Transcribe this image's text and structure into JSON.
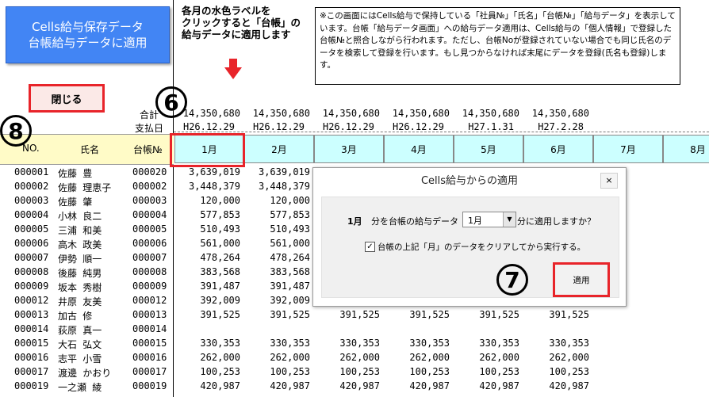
{
  "banner": {
    "line1": "Cells給与保存データ",
    "line2": "台帳給与データに適用"
  },
  "close_button": "閉じる",
  "instruction": {
    "l1": "各月の水色ラベルを",
    "l2": "クリックすると「台帳」の",
    "l3": "給与データに適用します"
  },
  "notice": "※この画面にはCells給与で保持している「社員№」「氏名」「台帳№」「給与データ」を表示しています。台帳「給与データ画面」への給与データ適用は、Cells給与の「個人情報」で登録した台帳№と照合しながら行われます。ただし、台帳Noが登録されていない場合でも同じ氏名のデータを検索して登録を行います。もし見つからなければ末尾にデータを登録(氏名も登録)します。",
  "totals": {
    "label": "合計",
    "values": [
      "14,350,680",
      "14,350,680",
      "14,350,680",
      "14,350,680",
      "14,350,680",
      "14,350,680"
    ]
  },
  "paydates": {
    "label": "支払日",
    "values": [
      "H26.12.29",
      "H26.12.29",
      "H26.12.29",
      "H26.12.29",
      "H27.1.31",
      "H27.2.28"
    ]
  },
  "columns": {
    "no": "NO.",
    "name": "氏名",
    "ledger": "台帳№"
  },
  "months": [
    "1月",
    "2月",
    "3月",
    "4月",
    "5月",
    "6月",
    "7月",
    "8月"
  ],
  "rows": [
    {
      "no": "000001",
      "name": "佐藤 豊",
      "ledger": "000020",
      "v": [
        "3,639,019",
        "3,639,019",
        "",
        "",
        "",
        "",
        ""
      ]
    },
    {
      "no": "000002",
      "name": "佐藤 理恵子",
      "ledger": "000002",
      "v": [
        "3,448,379",
        "3,448,379",
        "",
        "",
        "",
        "",
        ""
      ]
    },
    {
      "no": "000003",
      "name": "佐藤 肇",
      "ledger": "000003",
      "v": [
        "120,000",
        "120,000",
        "",
        "",
        "",
        "",
        ""
      ]
    },
    {
      "no": "000004",
      "name": "小林 良二",
      "ledger": "000004",
      "v": [
        "577,853",
        "577,853",
        "",
        "",
        "",
        "",
        ""
      ]
    },
    {
      "no": "000005",
      "name": "三浦 和美",
      "ledger": "000005",
      "v": [
        "510,493",
        "510,493",
        "",
        "",
        "",
        "",
        ""
      ]
    },
    {
      "no": "000006",
      "name": "高木 政美",
      "ledger": "000006",
      "v": [
        "561,000",
        "561,000",
        "",
        "",
        "",
        "",
        ""
      ]
    },
    {
      "no": "000007",
      "name": "伊勢 順一",
      "ledger": "000007",
      "v": [
        "478,264",
        "478,264",
        "",
        "",
        "",
        "",
        ""
      ]
    },
    {
      "no": "000008",
      "name": "後藤 純男",
      "ledger": "000008",
      "v": [
        "383,568",
        "383,568",
        "",
        "",
        "",
        "",
        ""
      ]
    },
    {
      "no": "000009",
      "name": "坂本 秀樹",
      "ledger": "000009",
      "v": [
        "391,487",
        "391,487",
        "",
        "",
        "",
        "",
        ""
      ]
    },
    {
      "no": "000012",
      "name": "井原 友美",
      "ledger": "000012",
      "v": [
        "392,009",
        "392,009",
        "",
        "",
        "",
        "",
        ""
      ]
    },
    {
      "no": "000013",
      "name": "加古 修",
      "ledger": "000013",
      "v": [
        "391,525",
        "391,525",
        "391,525",
        "391,525",
        "391,525",
        "391,525"
      ]
    },
    {
      "no": "000014",
      "name": "荻原 真一",
      "ledger": "000014",
      "v": [
        "",
        "",
        "",
        "",
        "",
        ""
      ]
    },
    {
      "no": "000015",
      "name": "大石 弘文",
      "ledger": "000015",
      "v": [
        "330,353",
        "330,353",
        "330,353",
        "330,353",
        "330,353",
        "330,353"
      ]
    },
    {
      "no": "000016",
      "name": "志平 小雪",
      "ledger": "000016",
      "v": [
        "262,000",
        "262,000",
        "262,000",
        "262,000",
        "262,000",
        "262,000"
      ]
    },
    {
      "no": "000017",
      "name": "渡邊 かおり",
      "ledger": "000017",
      "v": [
        "100,253",
        "100,253",
        "100,253",
        "100,253",
        "100,253",
        "100,253"
      ]
    },
    {
      "no": "000019",
      "name": "一之瀬 綾",
      "ledger": "000019",
      "v": [
        "420,987",
        "420,987",
        "420,987",
        "420,987",
        "420,987",
        "420,987"
      ]
    }
  ],
  "dialog": {
    "title": "Cells給与からの適用",
    "close_glyph": "×",
    "month_label": "1月",
    "prompt_a": "分を台帳の給与データ",
    "select_value": "1月",
    "prompt_b": "分に適用しますか？",
    "checkbox_label": "台帳の上記「月」のデータをクリアしてから実行する。",
    "checkbox_checked": true,
    "apply_button": "適用"
  },
  "callouts": {
    "six": "6",
    "seven": "7",
    "eight": "8"
  }
}
